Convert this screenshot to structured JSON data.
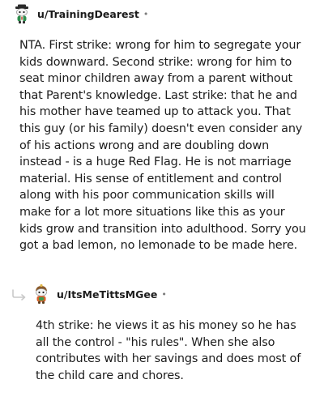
{
  "comments": [
    {
      "username": "u/TrainingDearest",
      "separator": "•",
      "avatar_icon": "snoo-avatar-icon",
      "body": "NTA. First strike: wrong for him to segregate your kids downward. Second strike: wrong for him to seat minor children away from a parent without that Parent's knowledge. Last strike: that he and his mother have teamed up to attack you. That this guy (or his family) doesn't even consider any of his actions wrong and are doubling down instead - is a huge Red Flag. He is not marriage material. His sense of entitlement and control along with his poor communication skills will make for a lot more situations like this as your kids grow and transition into adulthood. Sorry you got a bad lemon, no lemonade to be made here."
    },
    {
      "username": "u/ItsMeTittsMGee",
      "separator": "•",
      "avatar_icon": "snoo-avatar-icon",
      "reply_icon": "reply-arrow-icon",
      "body": "4th strike: he views it as his money so he has all the control - \"his rules\". When she also contributes with her savings and does most of the child care and chores."
    }
  ]
}
